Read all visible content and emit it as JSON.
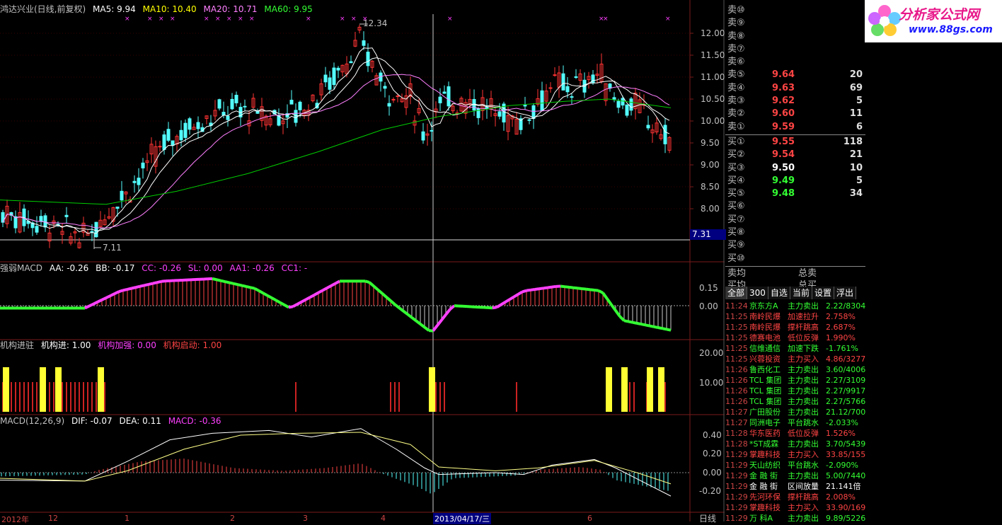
{
  "colors": {
    "up": "#ff3333",
    "down": "#54ffff",
    "ma5": "#ffffff",
    "ma10": "#ffff00",
    "ma20": "#ff80ff",
    "ma60": "#00cc00",
    "text": "#c0c0c0",
    "magenta": "#ff40ff",
    "green": "#33ff33",
    "yellow": "#ffff33",
    "red": "#cc2222"
  },
  "main_panel": {
    "title": "鸿达兴业(日线,前复权)",
    "ma5": "MA5: 9.94",
    "ma10": "MA10: 10.40",
    "ma20": "MA20: 10.71",
    "ma60": "MA60: 9.95",
    "high_label": "12.34",
    "low_label": "7.11",
    "last_price": "7.31",
    "axis": [
      "12.00",
      "11.50",
      "11.00",
      "10.50",
      "10.00",
      "9.50",
      "9.00",
      "8.50",
      "8.00"
    ]
  },
  "macd_strong": {
    "title": "强弱MACD",
    "aa": "AA: -0.26",
    "bb": "BB: -0.17",
    "cc": "CC: -0.26",
    "sl": "SL: 0.00",
    "aa1": "AA1: -0.26",
    "cc1": "CC1: -",
    "axis": [
      "0.15",
      "0.00"
    ]
  },
  "jigou": {
    "title": "机构进驻",
    "jin": "机构进: 1.00",
    "jiaqiang": "机构加强: 0.00",
    "qidong": "机构启动: 1.00",
    "axis": [
      "20.00",
      "10.00"
    ]
  },
  "macd": {
    "title": "MACD(12,26,9)",
    "dif": "DIF: -0.07",
    "dea": "DEA: 0.11",
    "macd": "MACD: -0.36",
    "axis": [
      "0.40",
      "0.20",
      "0.00",
      "-0.20"
    ]
  },
  "date_axis": {
    "labels": [
      "2012年",
      "12",
      "1",
      "2",
      "3",
      "4",
      "2013/04/17/三",
      "6"
    ],
    "period": "日线"
  },
  "orderbook": {
    "asks": [
      {
        "label": "卖⑩",
        "price": "",
        "vol": ""
      },
      {
        "label": "卖⑨",
        "price": "",
        "vol": ""
      },
      {
        "label": "卖⑧",
        "price": "",
        "vol": ""
      },
      {
        "label": "卖⑦",
        "price": "",
        "vol": ""
      },
      {
        "label": "卖⑥",
        "price": "",
        "vol": ""
      },
      {
        "label": "卖⑤",
        "price": "9.64",
        "vol": "20"
      },
      {
        "label": "卖④",
        "price": "9.63",
        "vol": "69"
      },
      {
        "label": "卖③",
        "price": "9.62",
        "vol": "5"
      },
      {
        "label": "卖②",
        "price": "9.60",
        "vol": "11"
      },
      {
        "label": "卖①",
        "price": "9.59",
        "vol": "6"
      }
    ],
    "bids": [
      {
        "label": "买①",
        "price": "9.55",
        "vol": "118",
        "color": "#ff4444"
      },
      {
        "label": "买②",
        "price": "9.54",
        "vol": "21",
        "color": "#ff4444"
      },
      {
        "label": "买③",
        "price": "9.50",
        "vol": "10",
        "color": "#ffffff"
      },
      {
        "label": "买④",
        "price": "9.49",
        "vol": "5",
        "color": "#33ff33"
      },
      {
        "label": "买⑤",
        "price": "9.48",
        "vol": "34",
        "color": "#33ff33"
      },
      {
        "label": "买⑥",
        "price": "",
        "vol": ""
      },
      {
        "label": "买⑦",
        "price": "",
        "vol": ""
      },
      {
        "label": "买⑧",
        "price": "",
        "vol": ""
      },
      {
        "label": "买⑨",
        "price": "",
        "vol": ""
      },
      {
        "label": "买⑩",
        "price": "",
        "vol": ""
      }
    ],
    "sell_avg": "卖均",
    "sell_total": "总卖",
    "buy_avg": "买均",
    "buy_total": "总买"
  },
  "tabs": [
    "全部",
    "300",
    "自选",
    "当前",
    "设置",
    "浮出"
  ],
  "ticker": [
    {
      "t": "11:24",
      "name": "京东方A",
      "act": "主力卖出",
      "val": "2.22/8304"
    },
    {
      "t": "11:25",
      "name": "南岭民爆",
      "act": "加速拉升",
      "val": "2.758%"
    },
    {
      "t": "11:25",
      "name": "南岭民爆",
      "act": "撑杆跳高",
      "val": "2.687%"
    },
    {
      "t": "11:25",
      "name": "德赛电池",
      "act": "低位反弹",
      "val": "1.990%"
    },
    {
      "t": "11:25",
      "name": "信维通信",
      "act": "加速下跌",
      "val": "-1.761%"
    },
    {
      "t": "11:25",
      "name": "兴蓉投资",
      "act": "主力买入",
      "val": "4.86/3277"
    },
    {
      "t": "11:26",
      "name": "鲁西化工",
      "act": "主力卖出",
      "val": "3.60/4006"
    },
    {
      "t": "11:26",
      "name": "TCL 集团",
      "act": "主力卖出",
      "val": "2.27/3109"
    },
    {
      "t": "11:26",
      "name": "TCL 集团",
      "act": "主力卖出",
      "val": "2.27/9917"
    },
    {
      "t": "11:26",
      "name": "TCL 集团",
      "act": "主力卖出",
      "val": "2.27/5766"
    },
    {
      "t": "11:27",
      "name": "广田股份",
      "act": "主力卖出",
      "val": "21.12/700"
    },
    {
      "t": "11:27",
      "name": "同洲电子",
      "act": "平台跳水",
      "val": "-2.033%"
    },
    {
      "t": "11:28",
      "name": "华东医药",
      "act": "低位反弹",
      "val": "1.526%"
    },
    {
      "t": "11:28",
      "name": "*ST成霖",
      "act": "主力卖出",
      "val": "3.70/5439"
    },
    {
      "t": "11:29",
      "name": "掌趣科技",
      "act": "主力买入",
      "val": "33.85/155"
    },
    {
      "t": "11:29",
      "name": "天山纺织",
      "act": "平台跳水",
      "val": "-2.090%"
    },
    {
      "t": "11:29",
      "name": "金 融 街",
      "act": "主力卖出",
      "val": "5.00/7440"
    },
    {
      "t": "11:29",
      "name": "金 融 街",
      "act": "区间放量",
      "val": "21.141倍"
    },
    {
      "t": "11:29",
      "name": "先河环保",
      "act": "撑杆跳高",
      "val": "2.008%"
    },
    {
      "t": "11:29",
      "name": "掌趣科技",
      "act": "主力买入",
      "val": "33.90/169"
    },
    {
      "t": "11:29",
      "name": "万  科A",
      "act": "主力卖出",
      "val": "9.89/5226"
    }
  ],
  "logo": {
    "text": "分析家公式网",
    "url": "www.88gs.com"
  }
}
